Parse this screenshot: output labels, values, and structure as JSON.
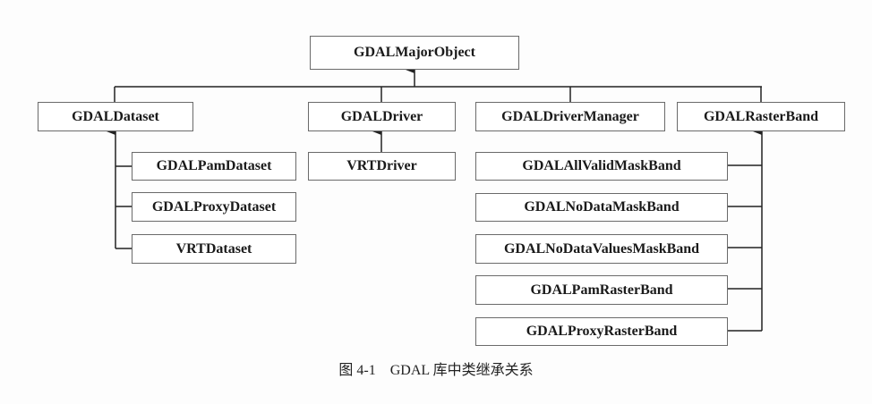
{
  "diagram": {
    "root": "GDALMajorObject",
    "children": [
      {
        "label": "GDALDataset",
        "subclasses": [
          "GDALPamDataset",
          "GDALProxyDataset",
          "VRTDataset"
        ]
      },
      {
        "label": "GDALDriver",
        "subclasses": [
          "VRTDriver"
        ]
      },
      {
        "label": "GDALDriverManager",
        "subclasses": []
      },
      {
        "label": "GDALRasterBand",
        "subclasses": [
          "GDALAllValidMaskBand",
          "GDALNoDataMaskBand",
          "GDALNoDataValuesMaskBand",
          "GDALPamRasterBand",
          "GDALProxyRasterBand"
        ]
      }
    ]
  },
  "caption": "图 4-1　GDAL 库中类继承关系",
  "colors": {
    "line": "#222222",
    "border": "#6a6a6a"
  }
}
